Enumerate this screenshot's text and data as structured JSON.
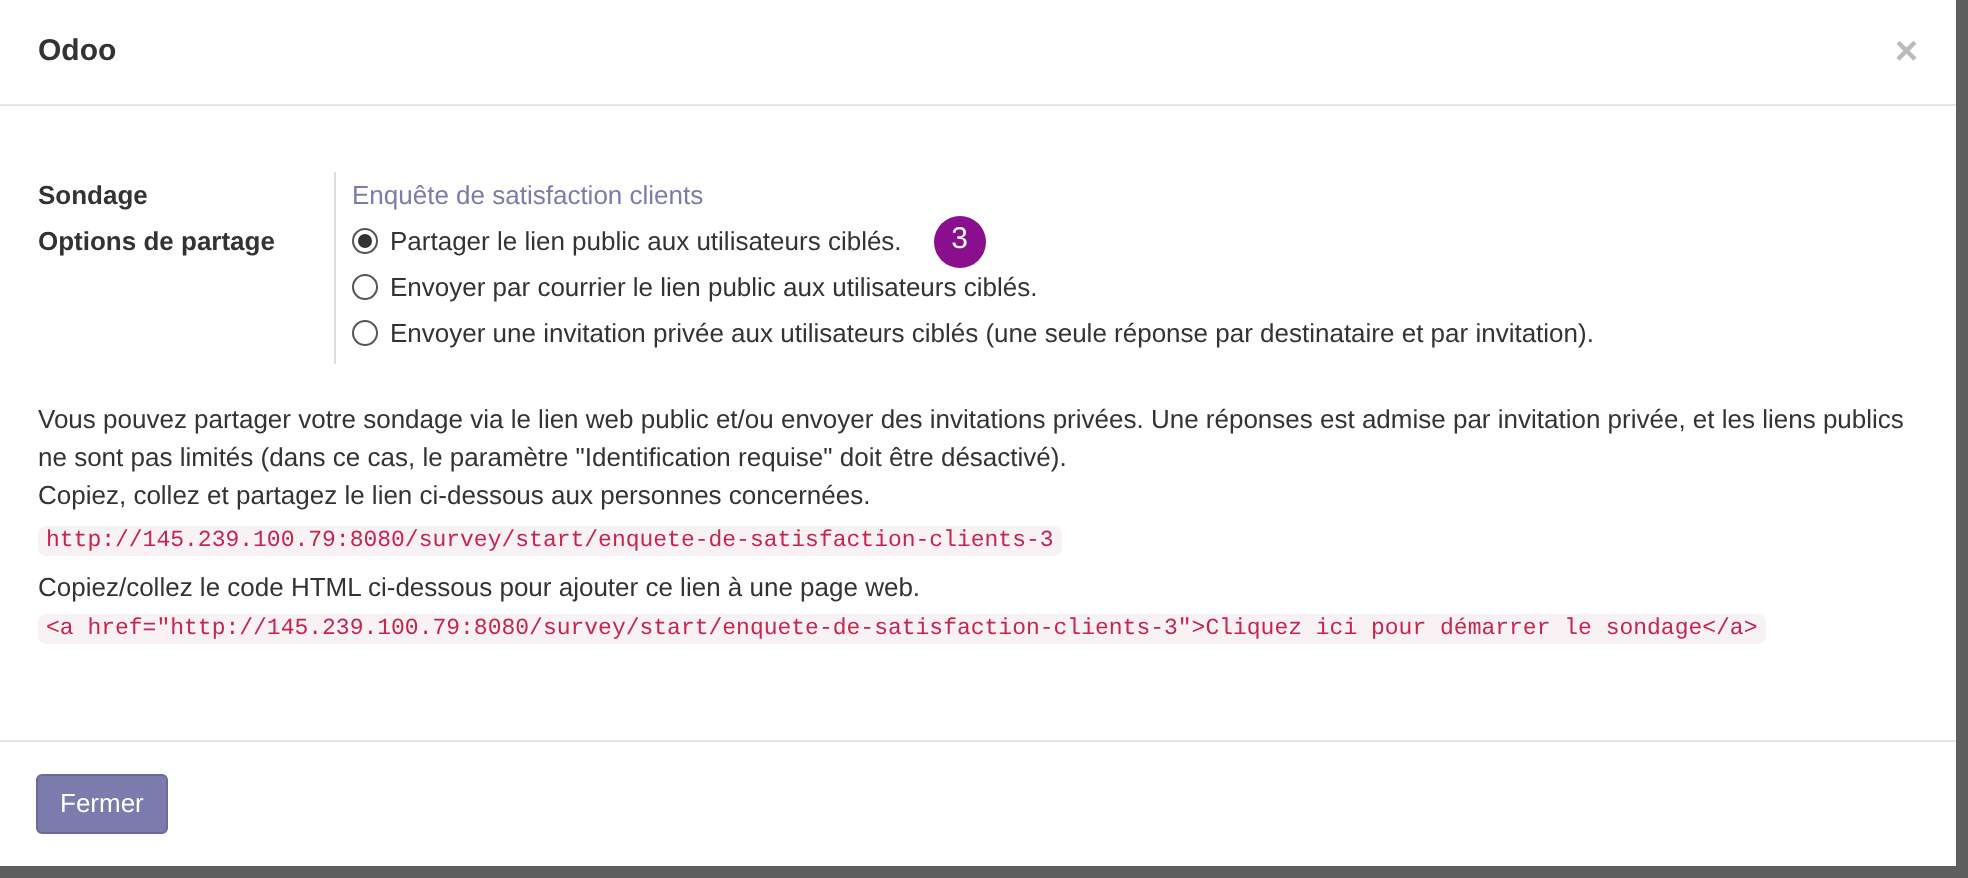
{
  "dialog": {
    "title": "Odoo",
    "close": "×"
  },
  "fields": [
    {
      "label": "Sondage",
      "kind": "link",
      "value": "Enquête de satisfaction clients"
    },
    {
      "label": "Options de partage",
      "kind": "radio",
      "options": [
        {
          "label": "Partager le lien public aux utilisateurs ciblés.",
          "selected": true,
          "callout": "3"
        },
        {
          "label": "Envoyer par courrier le lien public aux utilisateurs ciblés.",
          "selected": false
        },
        {
          "label": "Envoyer une invitation privée aux utilisateurs ciblés (une seule réponse par destinataire et par invitation).",
          "selected": false
        }
      ]
    }
  ],
  "info": {
    "intro": "Vous pouvez partager votre sondage via le lien web public et/ou envoyer des invitations privées. Une réponses est admise par invitation privée, et les liens publics ne sont pas limités (dans ce cas, le paramètre \"Identification requise\" doit être désactivé).",
    "copy_instruction": "Copiez, collez et partagez le lien ci-dessous aux personnes concernées.",
    "url": "http://145.239.100.79:8080/survey/start/enquete-de-satisfaction-clients-3",
    "html_instruction": "Copiez/collez le code HTML ci-dessous pour ajouter ce lien à une page web.",
    "html_code": "<a href=\"http://145.239.100.79:8080/survey/start/enquete-de-satisfaction-clients-3\">Cliquez ici pour démarrer le sondage</a>"
  },
  "footer": {
    "buttons": [
      "Fermer"
    ]
  }
}
